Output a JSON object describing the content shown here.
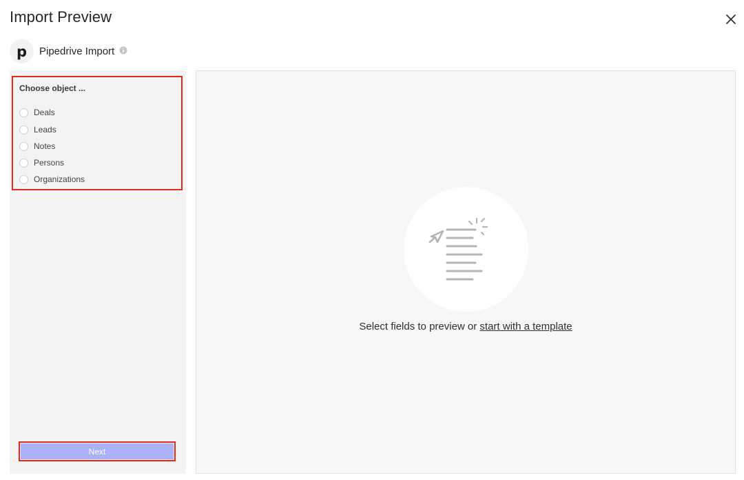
{
  "header": {
    "title": "Import Preview",
    "close_icon": "close-icon"
  },
  "source": {
    "logo_letter": "p",
    "name": "Pipedrive Import",
    "info_icon": "info-icon"
  },
  "object_picker": {
    "label": "Choose object ...",
    "options": [
      {
        "label": "Deals",
        "selected": false
      },
      {
        "label": "Leads",
        "selected": false
      },
      {
        "label": "Notes",
        "selected": false
      },
      {
        "label": "Persons",
        "selected": false
      },
      {
        "label": "Organizations",
        "selected": false
      }
    ]
  },
  "actions": {
    "next_label": "Next",
    "next_color": "#aab1f6"
  },
  "preview": {
    "empty_text": "Select fields to preview or ",
    "template_link": "start with a template",
    "illustration_icon": "document-send-icon"
  },
  "colors": {
    "highlight": "#e0281c"
  }
}
